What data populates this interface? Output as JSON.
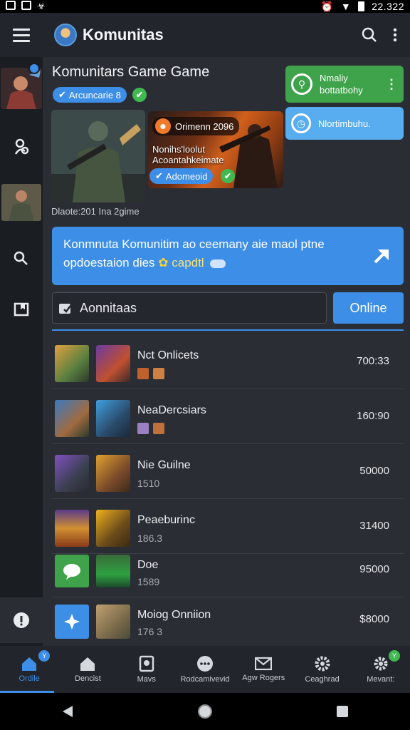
{
  "status_bar": {
    "time": "22.322"
  },
  "app_bar": {
    "title": "Komunitas"
  },
  "header": {
    "game_title": "Komunitars Game Game",
    "chip_label": "Arcuncarie 8"
  },
  "cards": {
    "green_line1": "Nmaliy",
    "green_line2": "bottatbohy",
    "blue_label": "Nlortimbuhu."
  },
  "artwork": {
    "badge": "Orimenn 2096",
    "caption_line1": "Nonihs'loolut",
    "caption_line2": "Acoantahkeimate",
    "chip": "Adomeoid",
    "footer": "Dlaote:201 Ina  2gime"
  },
  "banner": {
    "line1": "Konmnuta Komunitim ao ceemany aie maol ptne",
    "line2": "opdoestaion dies",
    "line2_tail": "capdtl"
  },
  "search": {
    "value": "Aonnitaas"
  },
  "online_button": "Online",
  "rows": [
    {
      "name": "Nct Onlicets",
      "sub": "",
      "value": "700:33"
    },
    {
      "name": "NeaDercsiars",
      "sub": "",
      "value": "160:90"
    },
    {
      "name": "Nie Guilne",
      "sub": "1510",
      "value": "50000"
    },
    {
      "name": "Peaeburinc",
      "sub": "186.3",
      "value": "31400"
    },
    {
      "name": "Doe",
      "sub": "1589",
      "value": "95000"
    },
    {
      "name": "Moiog Onniion",
      "sub": "176 3",
      "value": "$8000"
    }
  ],
  "bottom_nav": [
    {
      "label": "Ordile",
      "icon": "home-icon",
      "active": true,
      "badge": "Y"
    },
    {
      "label": "Dencist",
      "icon": "house-icon"
    },
    {
      "label": "Mavs",
      "icon": "map-icon"
    },
    {
      "label": "Rodcamivevid",
      "icon": "chat-icon"
    },
    {
      "label": "Agw Rogers",
      "icon": "mail-icon"
    },
    {
      "label": "Ceaghrad",
      "icon": "gear-icon"
    },
    {
      "label": "Mevant:",
      "icon": "settings-icon",
      "badge": "Y"
    }
  ],
  "colors": {
    "accent": "#3d8ee6",
    "green": "#3ea34a",
    "light_blue": "#58acf0",
    "background": "#2a2e34"
  }
}
